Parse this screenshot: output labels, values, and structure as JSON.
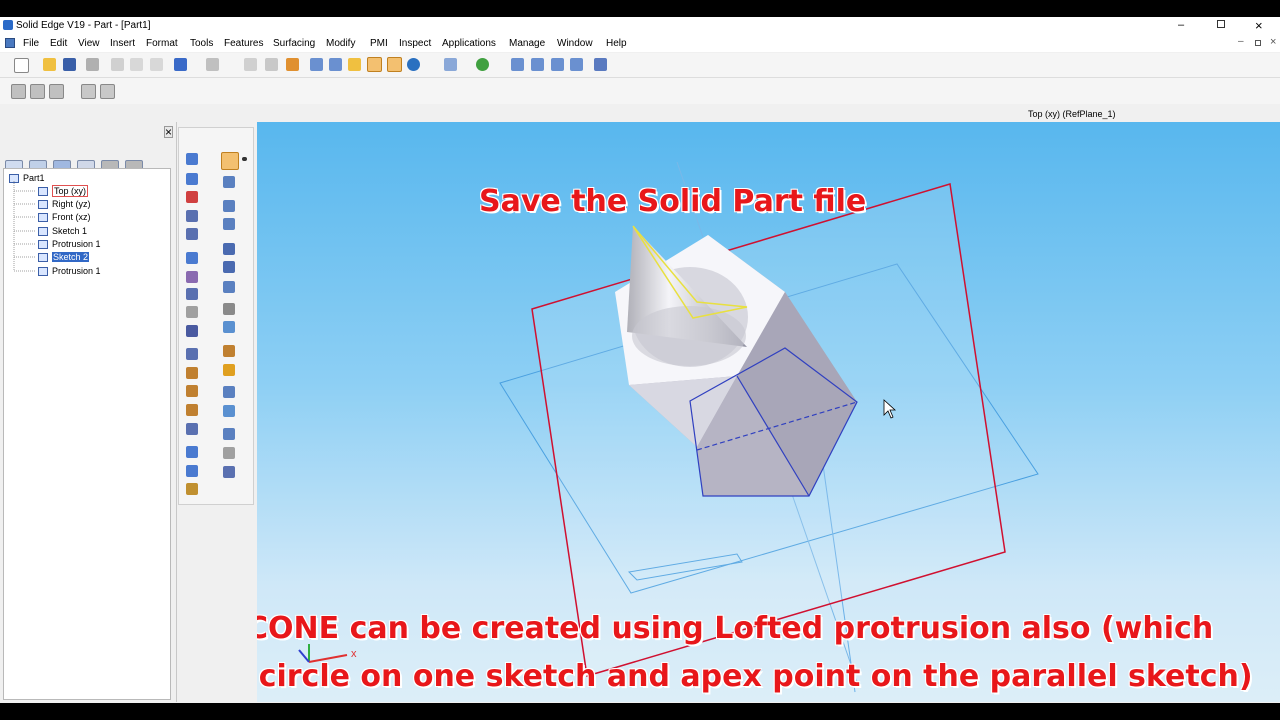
{
  "app": {
    "title": "Solid Edge V19 - Part - [Part1]"
  },
  "menu": [
    "File",
    "Edit",
    "View",
    "Insert",
    "Format",
    "Tools",
    "Features",
    "Surfacing",
    "Modify",
    "PMI",
    "Inspect",
    "Applications",
    "Manage",
    "Window",
    "Help"
  ],
  "viewport": {
    "plane_label": "Top (xy) (RefPlane_1)"
  },
  "tree": {
    "root": "Part1",
    "items": [
      "Top (xy)",
      "Right (yz)",
      "Front (xz)",
      "Sketch 1",
      "Protrusion 1",
      "Sketch 2",
      "Protrusion 1"
    ],
    "selected_index": 5
  },
  "overlay": {
    "heading": "Save the Solid Part file",
    "note_line1": "NOTE: CONE can be created using Lofted protrusion also (which",
    "note_line2": "requires circle on one sketch and apex point on the parallel sketch)"
  },
  "colors": {
    "accent": "#e8171a",
    "viewport_top": "#58b7ee",
    "viewport_bottom": "#dceef8",
    "selection": "#3168c6"
  }
}
